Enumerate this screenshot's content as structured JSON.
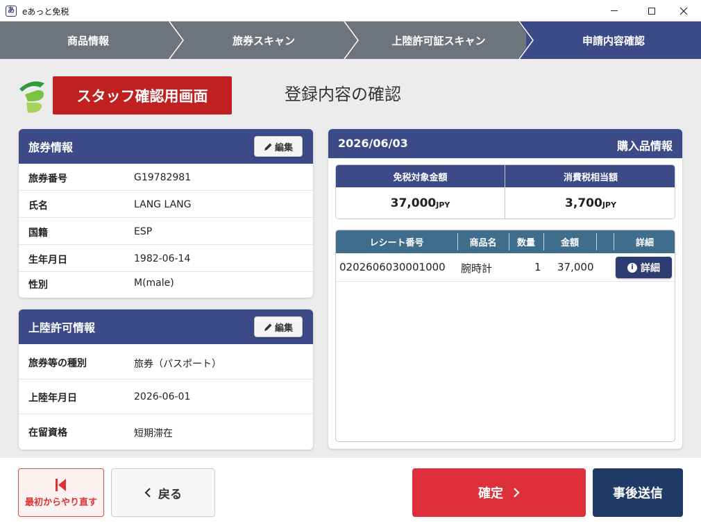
{
  "window": {
    "title": "eあっと免税",
    "icon_glyph": "あ"
  },
  "steps": [
    "商品情報",
    "旅券スキャン",
    "上陸許可証スキャン",
    "申請内容確認"
  ],
  "header": {
    "staff_banner": "スタッフ確認用画面",
    "page_title": "登録内容の確認"
  },
  "passport": {
    "title": "旅券情報",
    "edit_label": "編集",
    "rows": [
      {
        "label": "旅券番号",
        "value": "G19782981"
      },
      {
        "label": "氏名",
        "value": "LANG LANG"
      },
      {
        "label": "国籍",
        "value": "ESP"
      },
      {
        "label": "生年月日",
        "value": "1982-06-14"
      },
      {
        "label": "性別",
        "value": "M(male)"
      }
    ]
  },
  "landing": {
    "title": "上陸許可情報",
    "edit_label": "編集",
    "rows": [
      {
        "label": "旅券等の種別",
        "value": "旅券（パスポート）"
      },
      {
        "label": "上陸年月日",
        "value": "2026-06-01"
      },
      {
        "label": "在留資格",
        "value": "短期滞在"
      }
    ]
  },
  "purchase": {
    "date": "2026/06/03",
    "title": "購入品情報",
    "totals": [
      {
        "label": "免税対象金額",
        "value": "37,000",
        "unit": "JPY"
      },
      {
        "label": "消費税相当額",
        "value": "3,700",
        "unit": "JPY"
      }
    ],
    "columns": [
      "レシート番号",
      "商品名",
      "数量",
      "金額",
      "詳細"
    ],
    "rows": [
      {
        "receipt": "0202606030001000",
        "item": "腕時計",
        "qty": "1",
        "amount": "37,000",
        "detail_label": "詳細"
      }
    ]
  },
  "footer": {
    "restart_label": "最初からやり直す",
    "back_label": "戻る",
    "confirm_label": "確定",
    "later_label": "事後送信"
  },
  "colors": {
    "navy": "#3c4a88",
    "step_gray": "#6e747c",
    "staff_red": "#c0201f",
    "confirm_red": "#de2f3c",
    "later_navy": "#1f3a66",
    "receipt_header": "#3f6e8c"
  }
}
